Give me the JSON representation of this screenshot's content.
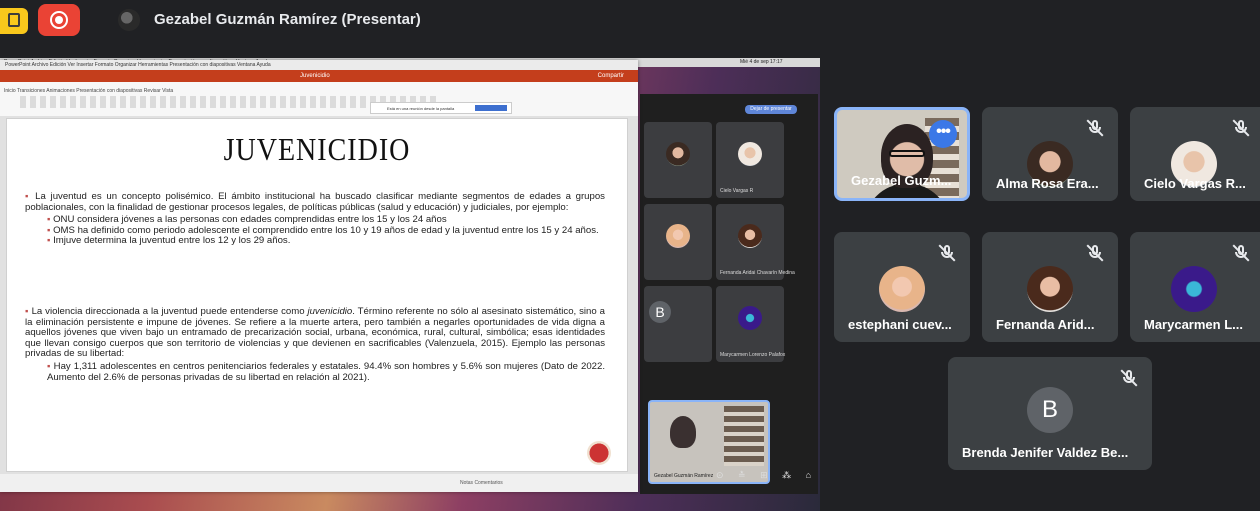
{
  "meet": {
    "presenter_title": "Gezabel Guzmán Ramírez (Presentar)"
  },
  "screen": {
    "mac_menu": "PowerPoint  Archivo  Edición  Ver  Insertar  Formato  Organizar  Herramientas  Presentación con diapositivas  Ventana  Ayuda",
    "mac_clock": "Mié 4 de sep  17:17",
    "ppt_doc_title": "Juvenicidio",
    "ppt_tabs": "Inicio  Transiciones  Animaciones  Presentación con diapositivas  Revisar  Vista",
    "ppt_share_btn": "Compartir",
    "notify_text": "Está en una reunión desde la pantalla",
    "notify_btn": "Dejar de compartir",
    "inner_present_btn": "Dejar de presentar",
    "inner_tiles": [
      {
        "label": "Cielo Vargas R"
      },
      {
        "label": "Fernanda Aridai Chavarín Medina"
      },
      {
        "label": "Marycarmen Lorenzo Palafox"
      },
      {
        "label": "Gezabel Guzmán Ramírez"
      }
    ],
    "inner_letter_b": "B",
    "status_text": "Notas   Comentarios"
  },
  "slide": {
    "title": "JUVENICIDIO",
    "p1": "La juventud es un concepto polisémico. El ámbito institucional ha buscado clasificar mediante segmentos de edades a grupos poblacionales, con la finalidad de gestionar procesos legales, de políticas públicas (salud y educación) y judiciales, por ejemplo:",
    "p1_sub1": "ONU considera jóvenes a las personas con edades comprendidas entre los 15 y los 24 años",
    "p1_sub2": "OMS ha definido como periodo adolescente el comprendido entre los 10 y 19 años de edad y la juventud entre los 15 y 24 años.",
    "p1_sub3": "Imjuve determina la juventud entre los 12 y los 29 años.",
    "p2_a": "La violencia direccionada a la juventud puede entenderse como ",
    "p2_em": "juvenicidio",
    "p2_b": ". Término referente no sólo al asesinato sistemático, sino a la eliminación persistente e impune de jóvenes. Se refiere a la muerte artera, pero también a negarles oportunidades de vida digna a aquellos jóvenes que viven bajo un entramado de precarización social, urbana, económica, rural, cultural, simbólica; esas identidades que llevan consigo cuerpos que son territorio de violencias y que devienen en sacrificables (Valenzuela, 2015). Ejemplo las personas privadas de su libertad:",
    "p2_sub1": "Hay 1,311 adolescentes en centros penitenciarios federales y estatales. 94.4% son hombres y 5.6% son mujeres (Dato de 2022. Aumento del 2.6% de personas privadas de su libertad en relación al 2021)."
  },
  "participants": [
    {
      "name": "Gezabel Guzm...",
      "more": "•••"
    },
    {
      "name": "Alma Rosa Era..."
    },
    {
      "name": "Cielo Vargas R..."
    },
    {
      "name": "estephani cuev..."
    },
    {
      "name": "Fernanda Arid..."
    },
    {
      "name": "Marycarmen L..."
    },
    {
      "name": "Brenda Jenifer Valdez Be...",
      "initial": "B"
    }
  ]
}
